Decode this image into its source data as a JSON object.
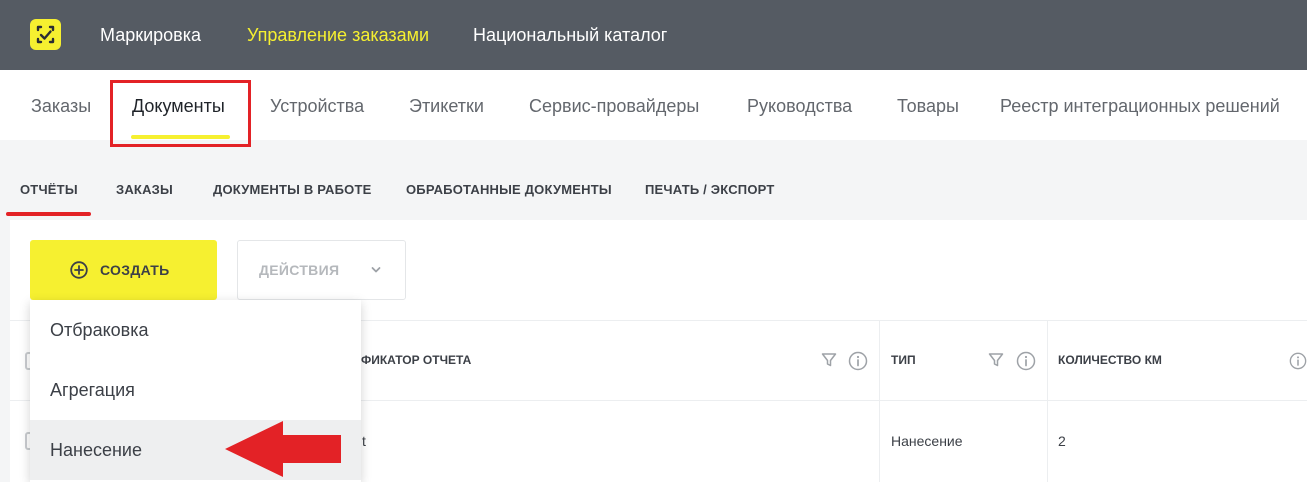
{
  "top_nav": {
    "items": [
      {
        "label": "Маркировка",
        "active": false
      },
      {
        "label": "Управление заказами",
        "active": true
      },
      {
        "label": "Национальный каталог",
        "active": false
      }
    ]
  },
  "section_nav": {
    "items": [
      {
        "label": "Заказы",
        "active": false
      },
      {
        "label": "Документы",
        "active": true
      },
      {
        "label": "Устройства",
        "active": false
      },
      {
        "label": "Этикетки",
        "active": false
      },
      {
        "label": "Сервис-провайдеры",
        "active": false
      },
      {
        "label": "Руководства",
        "active": false
      },
      {
        "label": "Товары",
        "active": false
      },
      {
        "label": "Реестр интеграционных решений",
        "active": false
      }
    ]
  },
  "sub_tabs": {
    "items": [
      {
        "label": "ОТЧЁТЫ",
        "active": true
      },
      {
        "label": "ЗАКАЗЫ",
        "active": false
      },
      {
        "label": "ДОКУМЕНТЫ В РАБОТЕ",
        "active": false
      },
      {
        "label": "ОБРАБОТАННЫЕ ДОКУМЕНТЫ",
        "active": false
      },
      {
        "label": "ПЕЧАТЬ / ЭКСПОРТ",
        "active": false
      }
    ]
  },
  "toolbar": {
    "create_label": "СОЗДАТЬ",
    "actions_label": "ДЕЙСТВИЯ"
  },
  "dropdown": {
    "items": [
      {
        "label": "Отбраковка",
        "highlighted": false
      },
      {
        "label": "Агрегация",
        "highlighted": false
      },
      {
        "label": "Нанесение",
        "highlighted": true
      }
    ]
  },
  "table": {
    "columns": [
      {
        "label": "ТИФИКАТОР ОТЧЕТА"
      },
      {
        "label": "ТИП"
      },
      {
        "label": "КОЛИЧЕСТВО КМ"
      }
    ],
    "rows": [
      {
        "id_fragment": "t",
        "type": "Нанесение",
        "count": "2"
      }
    ]
  },
  "colors": {
    "topbar": "#555b63",
    "accent_yellow": "#f6f030",
    "annotation_red": "#e32226"
  },
  "icons": [
    "logo-icon",
    "plus-circle-icon",
    "chevron-down-icon",
    "filter-icon",
    "info-icon",
    "annotation-arrow-icon"
  ]
}
